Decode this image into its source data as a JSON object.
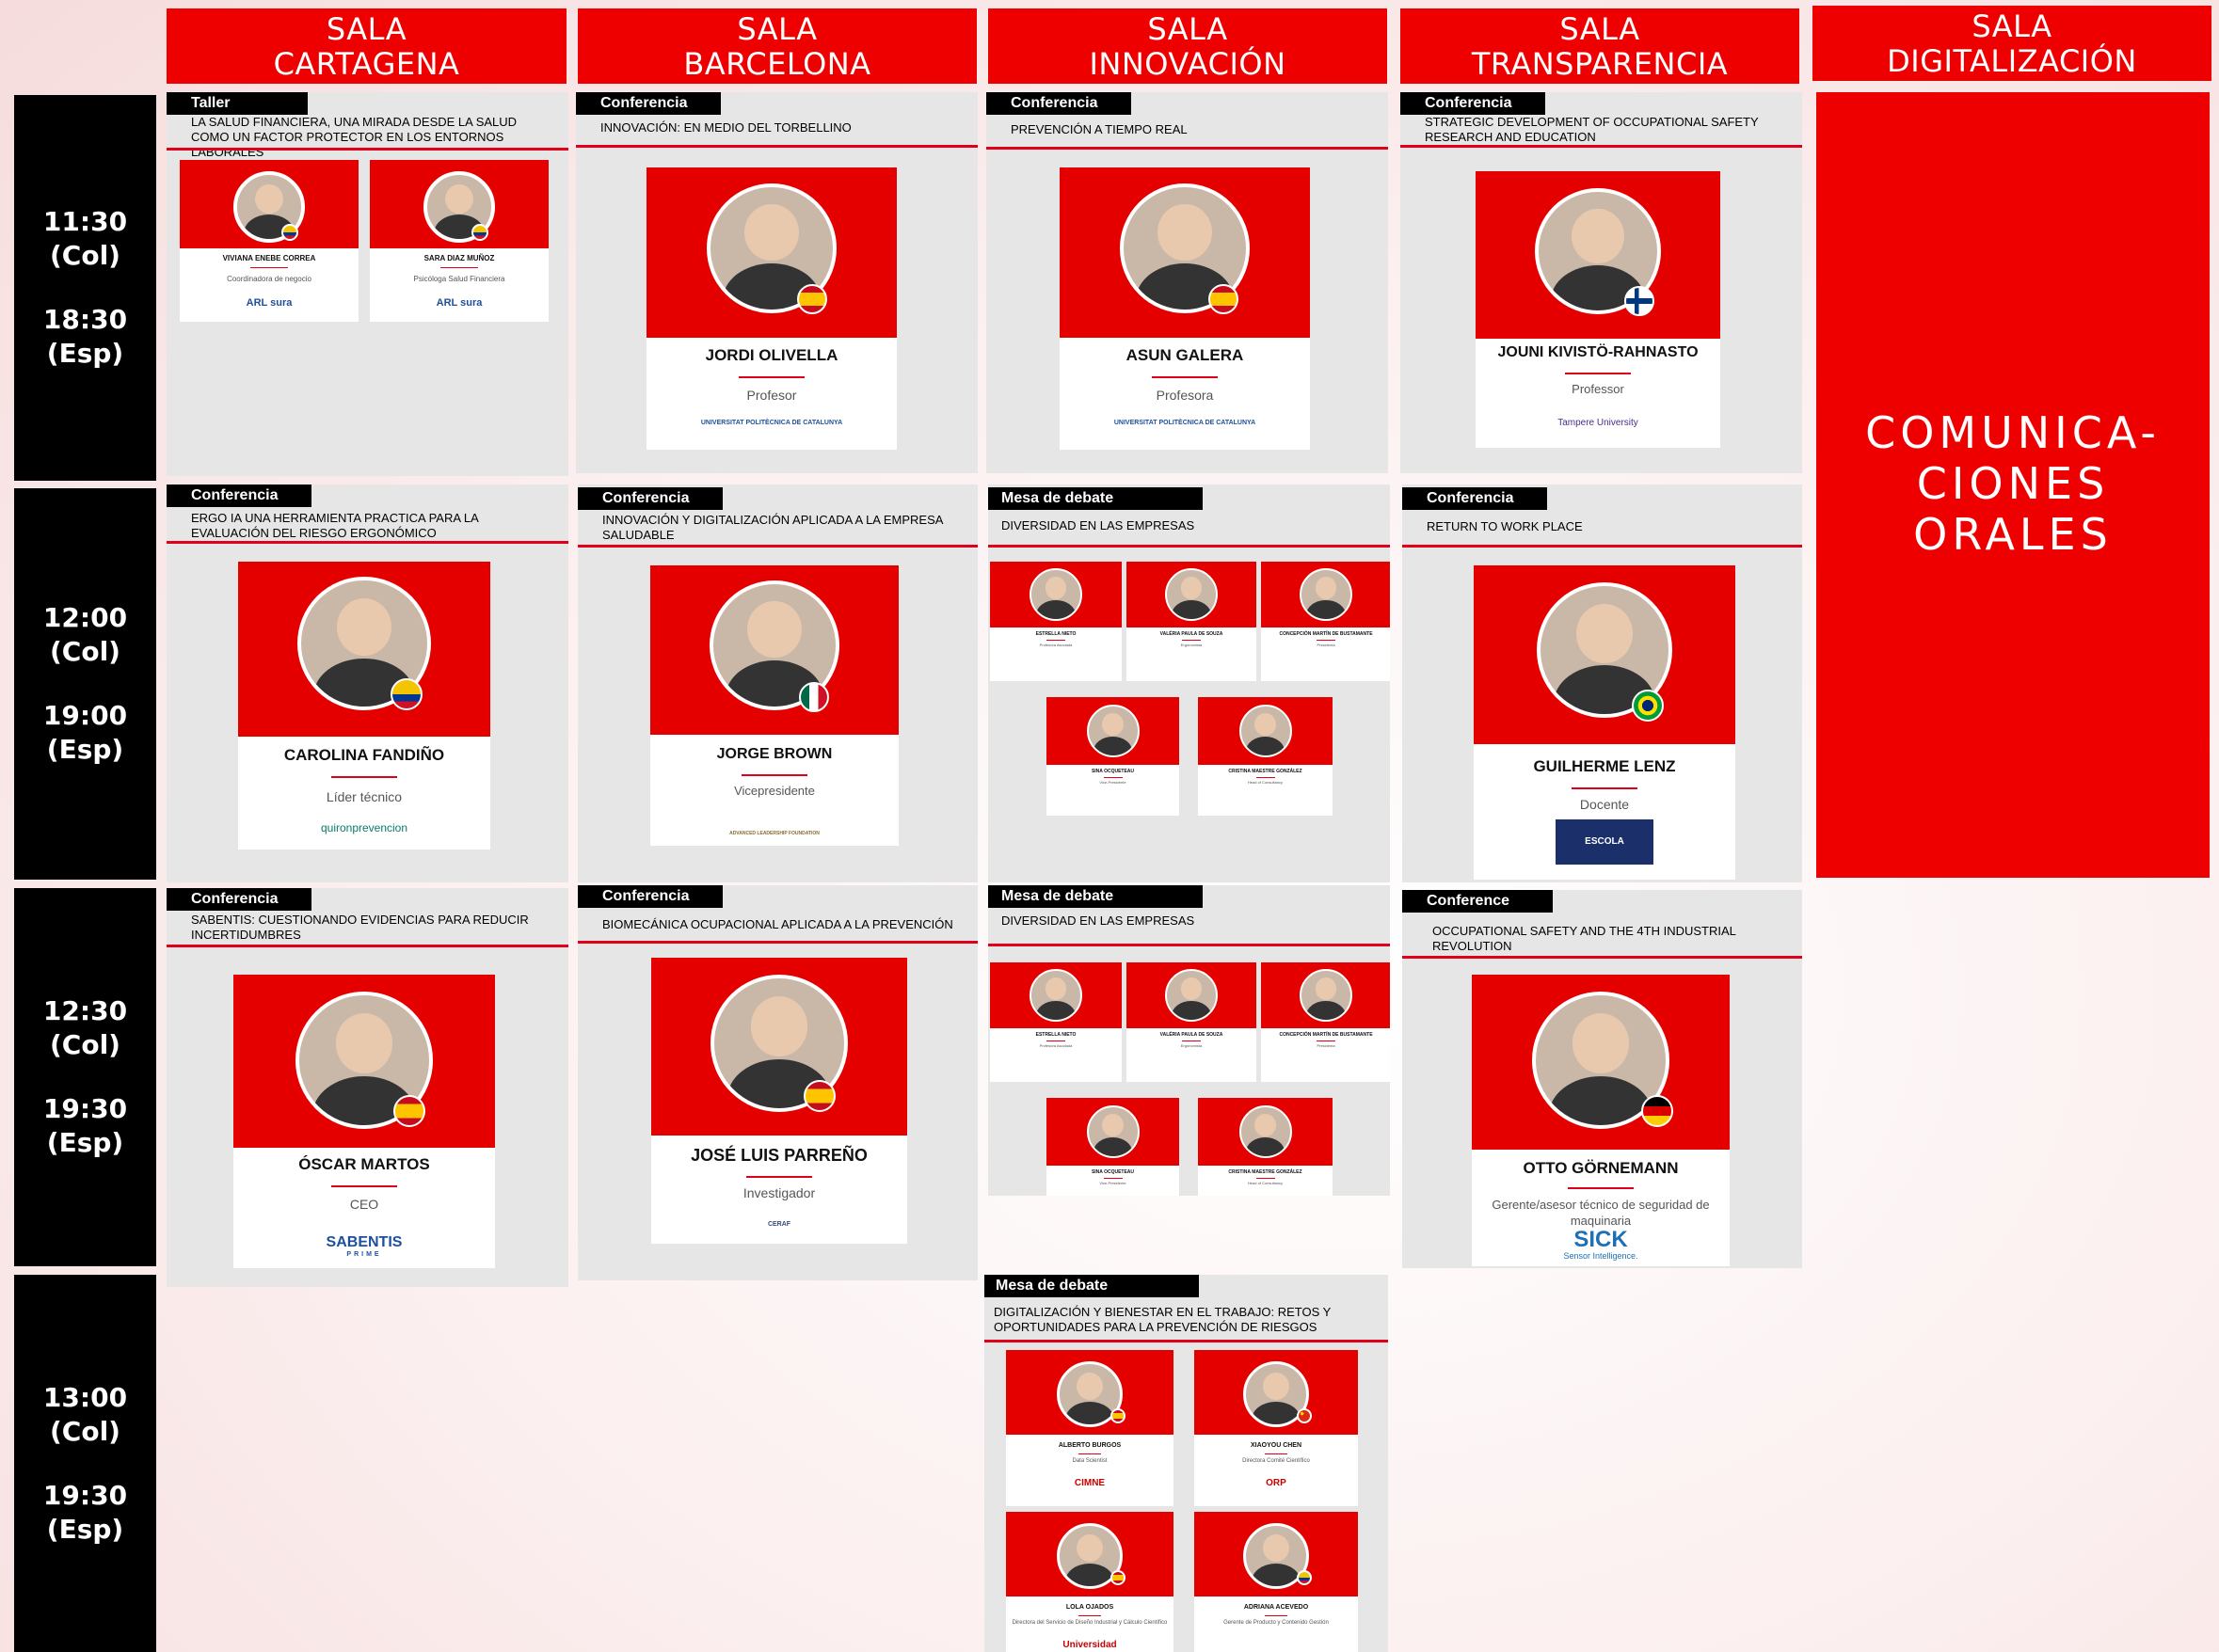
{
  "rooms": [
    {
      "line1": "SALA",
      "line2": "CARTAGENA"
    },
    {
      "line1": "SALA",
      "line2": "BARCELONA"
    },
    {
      "line1": "SALA",
      "line2": "INNOVACIÓN"
    },
    {
      "line1": "SALA",
      "line2": "TRANSPARENCIA"
    },
    {
      "line1": "SALA",
      "line2": "DIGITALIZACIÓN"
    }
  ],
  "times": [
    {
      "col": "11:30",
      "col_tz": "(Col)",
      "esp": "18:30",
      "esp_tz": "(Esp)"
    },
    {
      "col": "12:00",
      "col_tz": "(Col)",
      "esp": "19:00",
      "esp_tz": "(Esp)"
    },
    {
      "col": "12:30",
      "col_tz": "(Col)",
      "esp": "19:30",
      "esp_tz": "(Esp)"
    },
    {
      "col": "13:00",
      "col_tz": "(Col)",
      "esp": "19:30",
      "esp_tz": "(Esp)"
    }
  ],
  "digitalizacion": {
    "line1": "COMUNICA-",
    "line2": "CIONES",
    "line3": "ORALES"
  },
  "s_cart_1": {
    "tag": "Taller",
    "title": "La salud financiera, una mirada desde la salud como un factor protector en los entornos laborales",
    "sp1": {
      "name": "VIVIANA ENEBE CORREA",
      "role": "Coordinadora de negocio",
      "org": "ARL sura"
    },
    "sp2": {
      "name": "SARA DIAZ MUÑOZ",
      "role": "Psicóloga Salud Financiera",
      "org": "ARL sura"
    }
  },
  "s_barc_1": {
    "tag": "Conferencia",
    "title": "Innovación: en medio del torbellino",
    "sp1": {
      "name": "JORDI OLIVELLA",
      "role": "Profesor",
      "org": "UNIVERSITAT POLITÈCNICA DE CATALUNYA"
    }
  },
  "s_inno_1": {
    "tag": "Conferencia",
    "title": "Prevención a tiempo real",
    "sp1": {
      "name": "ASUN GALERA",
      "role": "Profesora",
      "org": "UNIVERSITAT POLITÈCNICA DE CATALUNYA"
    }
  },
  "s_trans_1": {
    "tag": "Conferencia",
    "title": "Strategic development of occupational safety research and education",
    "sp1": {
      "name": "JOUNI KIVISTÖ-RAHNASTO",
      "role": "Professor",
      "org": "Tampere University"
    }
  },
  "s_cart_2": {
    "tag": "Conferencia",
    "title": "Ergo IA una herramienta practica para la evaluación del riesgo ergonómico",
    "sp1": {
      "name": "CAROLINA FANDIÑO",
      "role": "Líder técnico",
      "org": "quironprevencion"
    }
  },
  "s_barc_2": {
    "tag": "Conferencia",
    "title": "Innovación y digitalización aplicada a la empresa saludable",
    "sp1": {
      "name": "JORGE BROWN",
      "role": "Vicepresidente",
      "org": "ADVANCED LEADERSHIP FOUNDATION"
    }
  },
  "s_inno_2": {
    "tag": "Mesa de debate",
    "title": "Diversidad en las empresas",
    "panel": [
      {
        "name": "ESTRELLA NIETO",
        "role": "Profesora Asociada"
      },
      {
        "name": "VALÉRIA PAULA DE SOUZA",
        "role": "Ergonomista"
      },
      {
        "name": "CONCEPCIÓN MARTÍN DE BUSTAMANTE",
        "role": "Presidenta"
      },
      {
        "name": "SINA OCQUETEAU",
        "role": "Vice-Presidente"
      },
      {
        "name": "CRISTINA MAESTRE GONZÁLEZ",
        "role": "Head of Consultancy"
      }
    ]
  },
  "s_trans_2": {
    "tag": "Conferencia",
    "title": "Return to work place",
    "sp1": {
      "name": "GUILHERME LENZ",
      "role": "Docente",
      "org": "ESCOLA POLITÉCNICA"
    }
  },
  "s_cart_3": {
    "tag": "Conferencia",
    "title": "Sabentis: cuestionando evidencias para reducir incertidumbres",
    "sp1": {
      "name": "ÓSCAR MARTOS",
      "role": "CEO",
      "org": "SABENTIS",
      "org_sub": "PRIME"
    }
  },
  "s_barc_3": {
    "tag": "Conferencia",
    "title": "Biomecánica ocupacional aplicada a la prevención",
    "sp1": {
      "name": "JOSÉ LUIS PARREÑO",
      "role": "Investigador",
      "org": "CERAF"
    }
  },
  "s_inno_3": {
    "tag": "Mesa de debate",
    "title": "Diversidad en las empresas",
    "panel": [
      {
        "name": "ESTRELLA NIETO",
        "role": "Profesora Asociada"
      },
      {
        "name": "VALÉRIA PAULA DE SOUZA",
        "role": "Ergonomista"
      },
      {
        "name": "CONCEPCIÓN MARTÍN DE BUSTAMANTE",
        "role": "Presidenta"
      },
      {
        "name": "SINA OCQUETEAU",
        "role": "Vice-Presidente"
      },
      {
        "name": "CRISTINA MAESTRE GONZÁLEZ",
        "role": "Head of Consultancy"
      }
    ]
  },
  "s_trans_3": {
    "tag": "Conference",
    "title": "Occupational safety and the 4th industrial revolution",
    "sp1": {
      "name": "OTTO GÖRNEMANN",
      "role": "Gerente/asesor técnico de seguridad de maquinaria",
      "org": "SICK",
      "org_sub": "Sensor Intelligence."
    }
  },
  "s_inno_4": {
    "tag": "Mesa de debate",
    "title": "Digitalización y bienestar en el trabajo: retos y oportunidades para la prevención de riesgos",
    "panel": [
      {
        "name": "ALBERTO BURGOS",
        "role": "Data Scientist",
        "org": "CIMNE"
      },
      {
        "name": "XIAOYOU CHEN",
        "role": "Directora Comité Científico",
        "org": "ORP"
      },
      {
        "name": "LOLA OJADOS",
        "role": "Directora del Servicio de Diseño Industrial y Cálculo Científico",
        "org": "Universidad"
      },
      {
        "name": "ADRIANA ACEVEDO",
        "role": "Gerente de Producto y Contenido Gestión",
        "org": ""
      }
    ]
  },
  "colors": {
    "red": "#ee0000",
    "black": "#000000",
    "panel": "#e6e6e6"
  }
}
